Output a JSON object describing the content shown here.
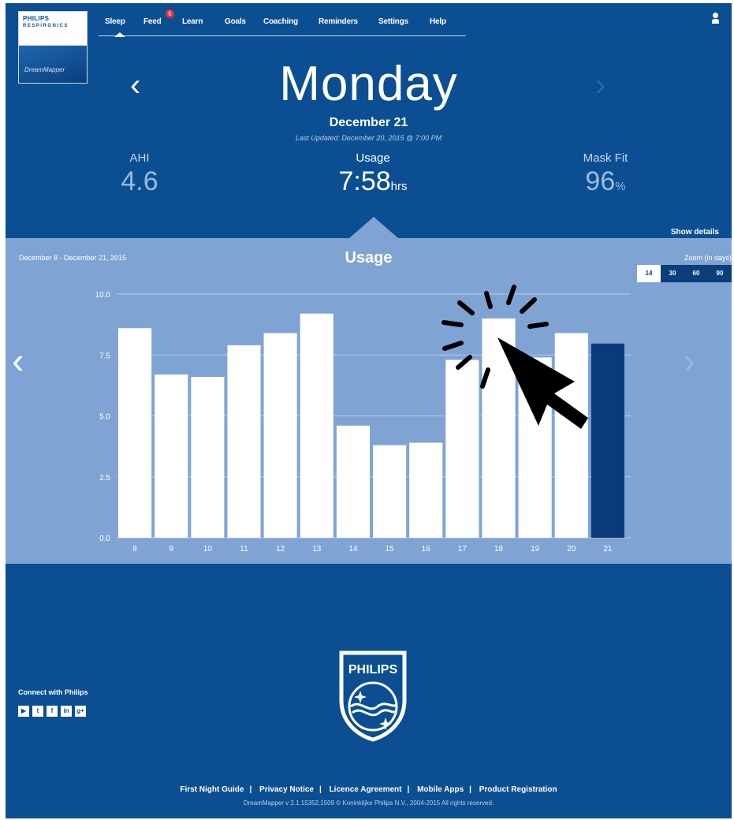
{
  "brand": {
    "philips": "PHILIPS",
    "respironics": "RESPIRONICS",
    "product": "DreamMapper"
  },
  "nav": {
    "items": [
      "Sleep",
      "Feed",
      "Learn",
      "Goals",
      "Coaching",
      "Reminders",
      "Settings",
      "Help"
    ],
    "feed_badge": "6",
    "active": "Sleep"
  },
  "day": {
    "name": "Monday",
    "date": "December 21",
    "last_updated": "Last Updated: December 20, 2015 @ 7:00 PM"
  },
  "metrics": {
    "ahi": {
      "label": "AHI",
      "value": "4.6"
    },
    "usage": {
      "label": "Usage",
      "value": "7:58",
      "unit": "hrs"
    },
    "mask_fit": {
      "label": "Mask Fit",
      "value": "96",
      "unit": "%"
    }
  },
  "panel": {
    "show_details": "Show details",
    "range": "December 8 - December 21, 2015",
    "zoom_label": "Zoom (in days)",
    "zoom_options": [
      "14",
      "30",
      "60",
      "90"
    ],
    "zoom_selected": "14"
  },
  "chart_data": {
    "type": "bar",
    "title": "Usage",
    "categories": [
      "8",
      "9",
      "10",
      "11",
      "12",
      "13",
      "14",
      "15",
      "16",
      "17",
      "18",
      "19",
      "20",
      "21"
    ],
    "values": [
      8.6,
      6.7,
      6.6,
      7.9,
      8.4,
      9.2,
      4.6,
      3.8,
      3.9,
      7.3,
      9.0,
      7.4,
      8.4,
      7.97
    ],
    "highlight_index": 13,
    "ylim": [
      0,
      10
    ],
    "yticks": [
      "0.0",
      "2.5",
      "5.0",
      "7.5",
      "10.0"
    ],
    "bar_color": "#ffffff",
    "highlight_color": "#0a3a7a",
    "grid": true
  },
  "footer": {
    "connect": "Connect with Philips",
    "social": [
      "youtube",
      "twitter",
      "facebook",
      "linkedin",
      "google-plus"
    ],
    "links": [
      "First Night Guide",
      "Privacy Notice",
      "Licence Agreement",
      "Mobile Apps",
      "Product Registration"
    ],
    "copyright": "DreamMapper v 2.1.15352.1509 © Koninklijke Philips N.V., 2004-2015 All rights reserved.",
    "logo_text": "PHILIPS"
  },
  "colors": {
    "background": "#0b4f92",
    "panel": "#7fa4d4",
    "accent_dark": "#0a3a7a"
  }
}
